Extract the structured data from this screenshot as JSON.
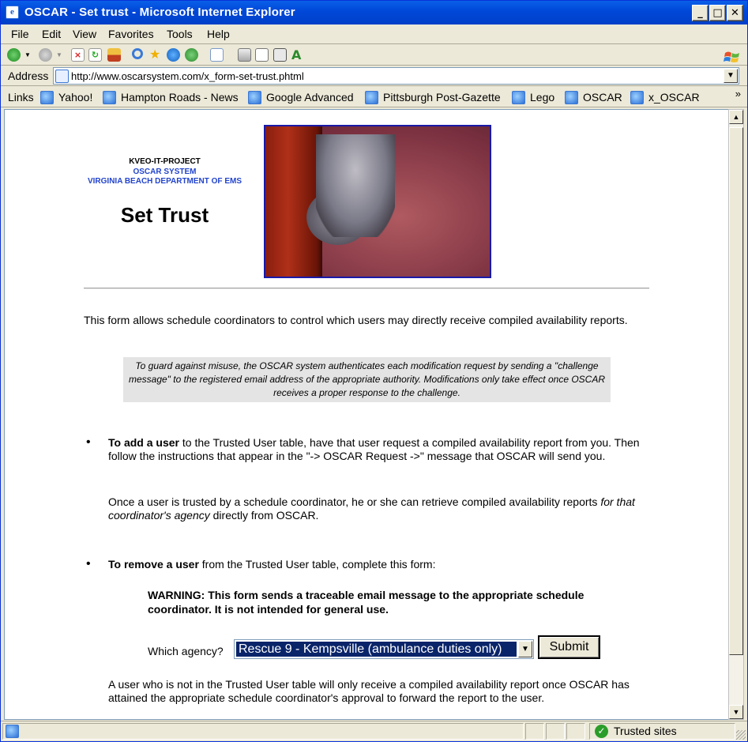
{
  "window": {
    "title": "OSCAR - Set trust - Microsoft Internet Explorer",
    "app_icon_glyph": "e",
    "controls": {
      "minimize": "_",
      "maximize": "□",
      "close": "✕"
    }
  },
  "menu": {
    "items": [
      {
        "label": "File"
      },
      {
        "label": "Edit"
      },
      {
        "label": "View"
      },
      {
        "label": "Favorites"
      },
      {
        "label": "Tools"
      },
      {
        "label": "Help"
      }
    ]
  },
  "toolbar": {
    "icons": [
      "back-icon",
      "back-dropdown-icon",
      "forward-icon",
      "forward-dropdown-icon",
      "stop-icon",
      "refresh-icon",
      "home-icon",
      "search-icon",
      "favorites-icon",
      "media-icon",
      "history-icon",
      "mail-icon",
      "print-icon",
      "edit-icon",
      "discuss-icon",
      "messenger-icon"
    ]
  },
  "address": {
    "label": "Address",
    "url": "http://www.oscarsystem.com/x_form-set-trust.phtml",
    "dropdown_glyph": "▼"
  },
  "links": {
    "label": "Links",
    "items": [
      {
        "label": "Yahoo!"
      },
      {
        "label": "Hampton Roads - News"
      },
      {
        "label": "Google Advanced"
      },
      {
        "label": "Pittsburgh Post-Gazette"
      },
      {
        "label": "Lego"
      },
      {
        "label": "OSCAR"
      },
      {
        "label": "x_OSCAR"
      }
    ],
    "more_glyph": "»"
  },
  "page": {
    "header_line1": "KVEO-IT-PROJECT",
    "header_line2": "OSCAR SYSTEM",
    "header_line3": "VIRGINIA BEACH DEPARTMENT OF EMS",
    "title": "Set Trust",
    "intro": "This form allows schedule coordinators to control which users may directly receive compiled availability reports.",
    "notice": "To guard against misuse, the OSCAR system authenticates each modification request by sending a \"challenge message\" to the registered email address of the appropriate authority.  Modifications only take effect once OSCAR receives a proper response to the challenge.",
    "add": {
      "bullet": "•",
      "lead": "To add a user",
      "text": " to the Trusted User table, have that user request a compiled availability report from you. Then follow the instructions that appear in the \"-> OSCAR Request ->\" message that OSCAR will send you.",
      "p2_a": "Once a user is trusted by a schedule coordinator, he or she can retrieve compiled availability reports ",
      "p2_em": "for that coordinator's agency",
      "p2_b": " directly from OSCAR."
    },
    "remove": {
      "bullet": "•",
      "lead": "To remove a user",
      "text": " from the Trusted User table, complete this form:",
      "warning": "WARNING:  This form sends a traceable email message to the appropriate schedule coordinator.  It is not intended for general use.",
      "agency_label": "Which agency?",
      "agency_selected": "Rescue 9 - Kempsville (ambulance duties only)",
      "submit_label": "Submit",
      "footer": "A user who is not in the Trusted User table will only receive a compiled availability report once OSCAR has attained the appropriate schedule coordinator's approval to forward the report to the user."
    }
  },
  "status": {
    "zone": "Trusted sites",
    "zone_glyph": "✓"
  },
  "colors": {
    "titlebar": "#0047d8",
    "header_blue": "#2244cc",
    "selection": "#0a246a",
    "notice_bg": "#e4e4e4"
  }
}
